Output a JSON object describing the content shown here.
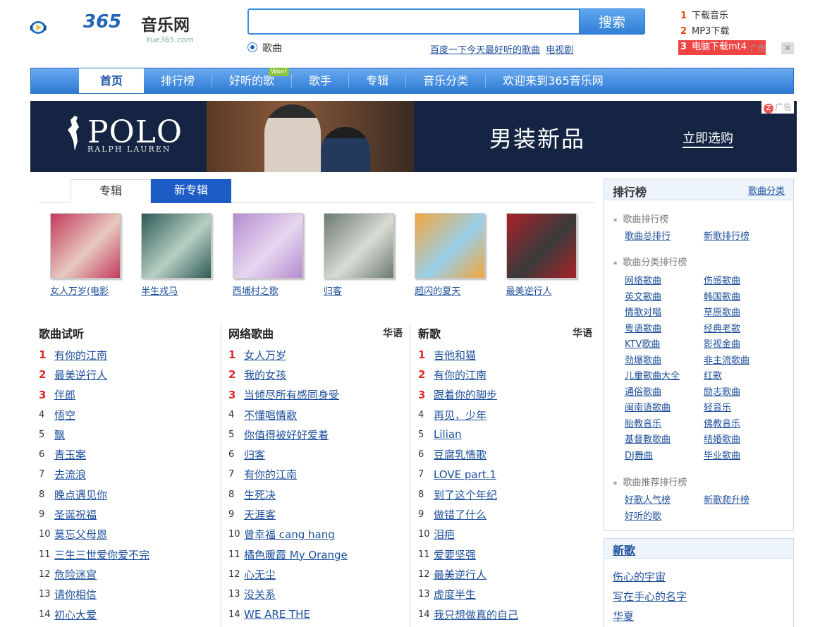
{
  "header": {
    "logo_num": "365",
    "logo_cn": "音乐网",
    "logo_domain": "Yue365.com",
    "search_placeholder": "",
    "search_button": "搜索",
    "radio_label": "歌曲",
    "hot_links": [
      "百度一下今天最好听的歌曲",
      "电视剧"
    ],
    "downloads": [
      {
        "num": "1",
        "label": "下载音乐"
      },
      {
        "num": "2",
        "label": "MP3下载"
      },
      {
        "num": "3",
        "label": "电脑下载mt4"
      }
    ],
    "dl_ad": "广告",
    "dl_close": "✕"
  },
  "nav": {
    "items": [
      "首页",
      "排行榜",
      "好听的歌",
      "歌手",
      "专辑",
      "音乐分类",
      "欢迎来到365音乐网"
    ],
    "badge": "Woo!"
  },
  "banner": {
    "brand": "POLO",
    "brand_sub": "RALPH LAUREN",
    "title": "男装新品",
    "cta": "立即选购",
    "ad_label": "广告",
    "ad_icon": "Z"
  },
  "albums_section": {
    "tabs": [
      "专辑",
      "新专辑"
    ],
    "albums": [
      {
        "name": "女人万岁(电影",
        "color_a": "#c23a5a",
        "color_b": "#e8c9c1"
      },
      {
        "name": "半生戎马",
        "color_a": "#2c5a56",
        "color_b": "#b8cfc3"
      },
      {
        "name": "西埔村之歌",
        "color_a": "#b48cd0",
        "color_b": "#e6d6ef"
      },
      {
        "name": "归客",
        "color_a": "#6c7a6f",
        "color_b": "#d8dcd6"
      },
      {
        "name": "超闪的夏天",
        "color_a": "#f2a63c",
        "color_b": "#9ad0ea"
      },
      {
        "name": "最美逆行人",
        "color_a": "#a8222a",
        "color_b": "#3a3a3a"
      }
    ]
  },
  "columns": [
    {
      "title": "歌曲试听",
      "lang": "",
      "songs": [
        "有你的江南",
        "最美逆行人",
        "伴郎",
        "悟空",
        "飘",
        "青玉案",
        "去流浪",
        "晚点遇见你",
        "圣诞祝福",
        "莫忘父母恩",
        "三生三世爱你爱不完",
        "危险迷宫",
        "请你相信",
        "初心大爱"
      ]
    },
    {
      "title": "网络歌曲",
      "lang": "华语",
      "songs": [
        "女人万岁",
        "我的女孩",
        "当倾尽所有感同身受",
        "不懂唱情歌",
        "你值得被好好爱着",
        "归客",
        "有你的江南",
        "生死决",
        "天涯客",
        "曾幸福 cang hang",
        "橘色暖霞 My Orange",
        "心无尘",
        "没关系",
        "WE ARE THE"
      ]
    },
    {
      "title": "新歌",
      "lang": "华语",
      "songs": [
        "吉他和猫",
        "有你的江南",
        "跟着你的脚步",
        "再见，少年",
        "Lilian",
        "豆腐乳情歌",
        "LOVE part.1",
        "到了这个年纪",
        "做错了什么",
        "泪疤",
        "爱要坚强",
        "最美逆行人",
        "虚度半生",
        "我只想做真的自己"
      ]
    }
  ],
  "sidebar": {
    "title": "排行榜",
    "more": "歌曲分类",
    "cat1": "歌曲排行榜",
    "cat1_links": [
      "歌曲总排行",
      "新歌排行榜"
    ],
    "cat2": "歌曲分类排行榜",
    "cat2_links": [
      "网络歌曲",
      "伤感歌曲",
      "英文歌曲",
      "韩国歌曲",
      "情歌对唱",
      "草原歌曲",
      "粤语歌曲",
      "经典老歌",
      "KTV歌曲",
      "影视金曲",
      "劲爆歌曲",
      "非主流歌曲",
      "儿童歌曲大全",
      "红歌",
      "通俗歌曲",
      "励志歌曲",
      "闽南语歌曲",
      "轻音乐",
      "胎教音乐",
      "佛教音乐",
      "基督教歌曲",
      "结婚歌曲",
      "DJ舞曲",
      "毕业歌曲"
    ],
    "cat3": "歌曲推荐排行榜",
    "cat3_links": [
      "好歌人气榜",
      "新歌爬升榜",
      "好听的歌"
    ],
    "new_title": "新歌",
    "new_items": [
      "伤心的宇宙",
      "写在手心的名字",
      "华夏"
    ]
  }
}
